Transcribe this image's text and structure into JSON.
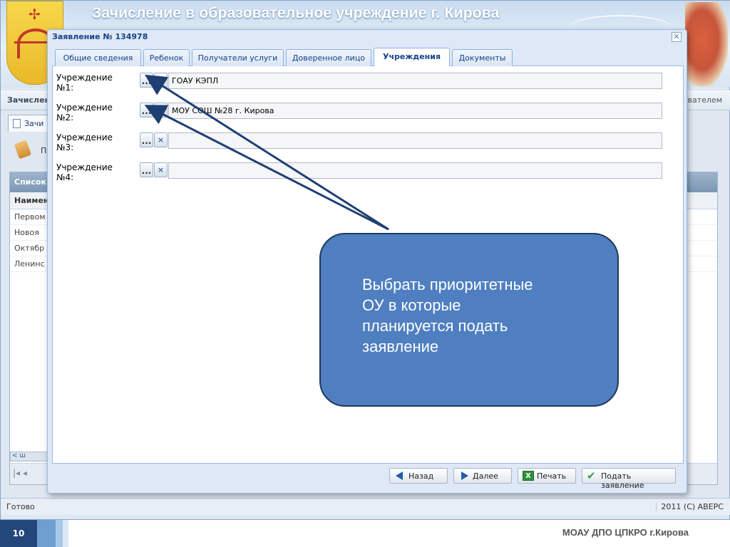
{
  "app": {
    "banner_title": "Зачисление в образовательное учреждение г. Кирова",
    "subheader_left": "Зачислен",
    "subheader_right": "вателем",
    "doc_tab_label": "Зачи",
    "toolbar_label": "П",
    "grid": {
      "header": "Список",
      "column": "Наимен",
      "rows": [
        "Первом",
        "Новоя",
        "Октябр",
        "Ленинс"
      ],
      "scroll_label": "< ш"
    },
    "status_left": "Готово",
    "status_right": "2011 (C) АВЕРС"
  },
  "dialog": {
    "title": "Заявление № 134978",
    "close_glyph": "✕",
    "tabs": [
      {
        "label": "Общие сведения",
        "active": false
      },
      {
        "label": "Ребенок",
        "active": false
      },
      {
        "label": "Получатели услуги",
        "active": false
      },
      {
        "label": "Доверенное лицо",
        "active": false
      },
      {
        "label": "Учреждения",
        "active": true
      },
      {
        "label": "Документы",
        "active": false
      }
    ],
    "fields": [
      {
        "label": "Учреждение\n№1:",
        "value": "ГОАУ КЭПЛ"
      },
      {
        "label": "Учреждение\n№2:",
        "value": "МОУ СОШ №28 г. Кирова"
      },
      {
        "label": "Учреждение\n№3:",
        "value": ""
      },
      {
        "label": "Учреждение\n№4:",
        "value": ""
      }
    ],
    "pick_glyph": "...",
    "clear_glyph": "×",
    "buttons": {
      "back": "Назад",
      "next": "Далее",
      "print": "Печать",
      "submit": "Подать заявление"
    },
    "icons": {
      "back": "arrow-left-icon",
      "next": "arrow-right-icon",
      "print": "excel-print-icon",
      "submit": "checkmark-icon"
    }
  },
  "callout": {
    "text": "Выбрать приоритетные\nОУ в которые\nпланируется подать\nзаявление"
  },
  "footer": {
    "slide_number": "10",
    "organization": "МОАУ ДПО ЦПКРО г.Кирова"
  },
  "colors": {
    "callout_fill": "#4f7fc0",
    "arrow": "#1f3f73",
    "dialog_title": "#15428b",
    "footer_accent": "#23477a"
  }
}
